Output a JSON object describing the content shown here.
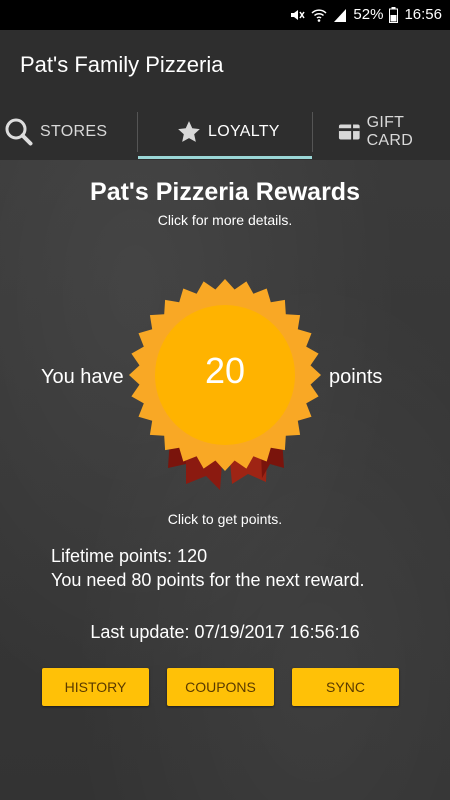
{
  "status_bar": {
    "battery": "52%",
    "time": "16:56"
  },
  "app": {
    "title": "Pat's Family Pizzeria"
  },
  "tabs": [
    {
      "label": "STORES",
      "icon": "search-icon"
    },
    {
      "label": "LOYALTY",
      "icon": "star-icon"
    },
    {
      "label": "GIFT CARD",
      "icon": "gift-card-icon"
    }
  ],
  "rewards": {
    "title": "Pat's Pizzeria Rewards",
    "subtitle": "Click for more details.",
    "you_have": "You have",
    "points_value": "20",
    "points_word": "points",
    "click_points": "Click to get points."
  },
  "stats": {
    "lifetime": "Lifetime points: 120",
    "next_reward": "You need 80 points for the next reward.",
    "last_update": "Last update: 07/19/2017 16:56:16"
  },
  "buttons": {
    "history": "HISTORY",
    "coupons": "COUPONS",
    "sync": "SYNC"
  },
  "colors": {
    "accent": "#ffc107",
    "badge_outer": "#f9a825",
    "badge_inner": "#ffb300",
    "ribbon": "#8b1a10",
    "tab_indicator": "#9ad6d6"
  }
}
